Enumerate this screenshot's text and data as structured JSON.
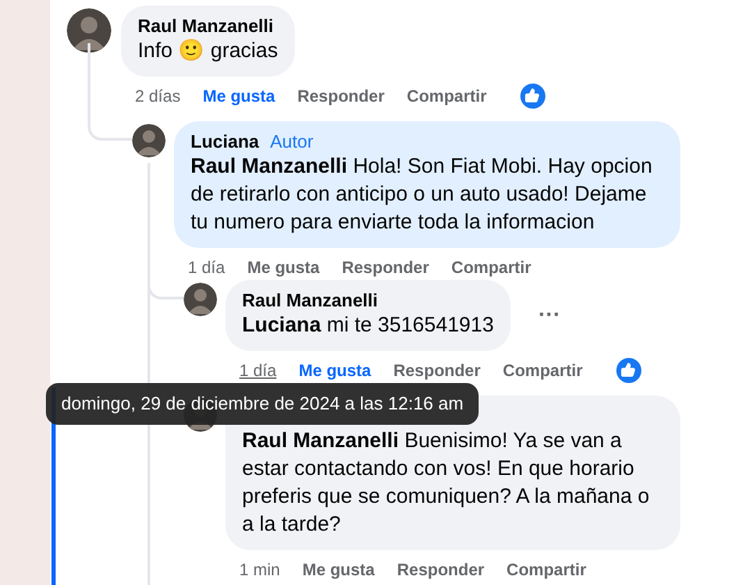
{
  "comments": [
    {
      "author": "Raul Manzanelli",
      "text": "Info 🙂 gracias",
      "tinted": false,
      "time": "2 días",
      "time_hovered": false,
      "like_label": "Me gusta",
      "liked": true,
      "reply_label": "Responder",
      "share_label": "Compartir",
      "reacted": true,
      "children": [
        {
          "author": "Luciana",
          "badge": "Autor",
          "text": "**Raul Manzanelli** Hola! Son Fiat Mobi. Hay opcion de retirarlo con anticipo o un auto usado! Dejame tu numero para enviarte toda la informacion",
          "tinted": true,
          "time": "1 día",
          "time_hovered": false,
          "like_label": "Me gusta",
          "liked": false,
          "reply_label": "Responder",
          "share_label": "Compartir",
          "children": [
            {
              "author": "Raul Manzanelli",
              "text": "**Luciana** mi te 3516541913",
              "tinted": false,
              "more_menu": "···",
              "time": "1 día",
              "time_hovered": true,
              "like_label": "Me gusta",
              "liked": true,
              "reply_label": "Responder",
              "share_label": "Compartir",
              "reacted": true
            },
            {
              "text": "**Raul Manzanelli** Buenisimo! Ya se van a estar contactando con vos! En que horario preferis que se comuniquen? A la mañana o a la tarde?",
              "tinted": false,
              "highlighted": true,
              "time": "1 min",
              "time_hovered": false,
              "like_label": "Me gusta",
              "liked": false,
              "reply_label": "Responder",
              "share_label": "Compartir"
            }
          ]
        }
      ]
    }
  ],
  "tooltip": {
    "text": "domingo, 29 de diciembre de 2024 a las 12:16 am"
  }
}
